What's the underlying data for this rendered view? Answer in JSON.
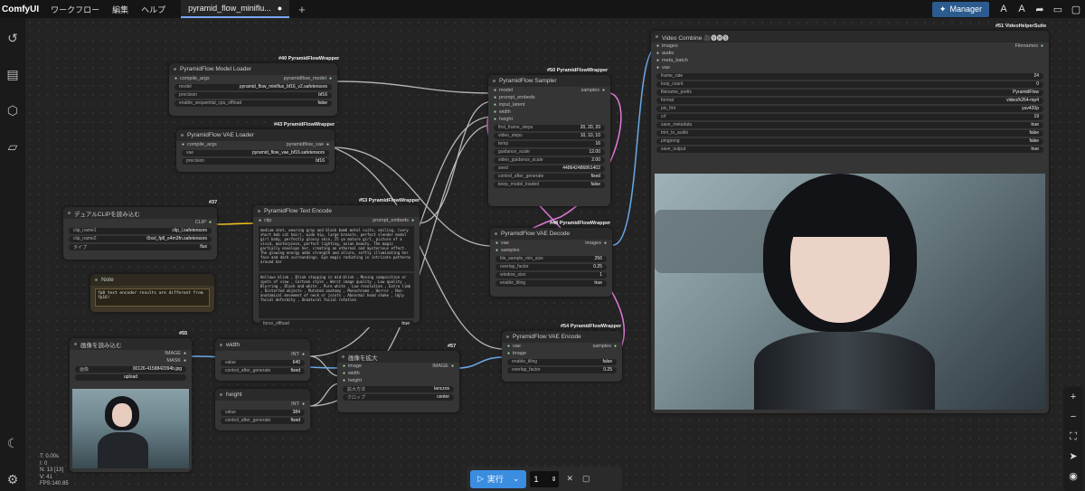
{
  "topbar": {
    "logo": "ComfyUI",
    "menu": [
      "ワークフロー",
      "編集",
      "ヘルプ"
    ],
    "tab": "pyramid_flow_miniflu...",
    "tab_dot": "●",
    "plus": "+",
    "manager": "Manager"
  },
  "nodes": {
    "model_loader": {
      "tag": "#40 PyramidFlowWrapper",
      "title": "PyramidFlow Model Loader",
      "in": "compile_args",
      "out": "pyramidflow_model",
      "w": [
        [
          "model",
          "pyramid_flow_miniflux_bf16_v2.safetensors"
        ],
        [
          "precision",
          "bf16"
        ]
      ],
      "toggle": [
        "enable_sequential_cpu_offload",
        "false"
      ]
    },
    "vae_loader": {
      "tag": "#43 PyramidFlowWrapper",
      "title": "PyramidFlow VAE Loader",
      "in": "compile_args",
      "out": "pyramidflow_vae",
      "w": [
        [
          "vae",
          "pyramid_flow_vae_bf16.safetensors"
        ],
        [
          "precision",
          "bf16"
        ]
      ]
    },
    "clip": {
      "tag": "#37",
      "title": "デュアルCLIPを読み込む",
      "out": "CLIP",
      "w": [
        [
          "clip_name1",
          "clip_l.safetensors"
        ],
        [
          "clip_name2",
          "t5xxl_fp8_e4m3fn.safetensors"
        ],
        [
          "タイプ",
          "flux"
        ]
      ]
    },
    "note": {
      "title": "Note",
      "text": "fp8 text encoder results are different from fp16!"
    },
    "text_encode": {
      "tag": "#53 PyramidFlowWrapper",
      "title": "PyramidFlow Text Encode",
      "in": "clip",
      "out": "prompt_embeds",
      "pos": "medium shot, wearing gray and black bomb metal suits, smiling, (very short bob cut hair), wide hip, large breasts, perfect slender model girl body, perfectly glossy skin, 25 yo mature girl, picture of a vivid, masterpiece, perfect lighting, asian beauty. The magic partially envelops her, creating an ethereal and mysterious effect. The glowing energy adds strength and allure, softly illuminating her face and dark surroundings. Eye magic radiating in intricate patterns around her",
      "neg": "Hollows blink , Blink stopping in mid-blink , Moving composition or spots of view , Cartoon style , Worst image quality , Low quality , Blurring , Black and white , Pure white , Low resolution , Extra limb , Distorted objects , Mutated anatomy , Monochrome , Horror , Non-anatomical movement of neck or joints , Abnormal head shake , Ugly facial deformity , Unnatural facial rotation",
      "toggle": [
        "force_offload",
        "true"
      ]
    },
    "sampler": {
      "tag": "#50 PyramidFlowWrapper",
      "title": "PyramidFlow Sampler",
      "ins": [
        "model",
        "prompt_embeds",
        "input_latent",
        "width",
        "height"
      ],
      "out": "samples",
      "w": [
        [
          "first_frame_steps",
          "20, 20, 20"
        ],
        [
          "video_steps",
          "10, 10, 10"
        ],
        [
          "temp",
          "16"
        ],
        [
          "guidance_scale",
          "12.00"
        ],
        [
          "video_guidance_scale",
          "2.00"
        ],
        [
          "seed",
          "448642486861402"
        ],
        [
          "control_after_generate",
          "fixed"
        ]
      ],
      "toggle": [
        "keep_model_loaded",
        "false"
      ]
    },
    "vae_decode": {
      "tag": "#48 PyramidFlowWrapper",
      "title": "PyramidFlow VAE Decode",
      "ins": [
        "vae",
        "samples"
      ],
      "out": "images",
      "w": [
        [
          "tile_sample_min_size",
          "256"
        ],
        [
          "overlap_factor",
          "0.25"
        ],
        [
          "window_size",
          "1"
        ]
      ],
      "toggle": [
        "enable_tiling",
        "true"
      ]
    },
    "vae_encode": {
      "tag": "#54 PyramidFlowWrapper",
      "title": "PyramidFlow VAE Encode",
      "ins": [
        "vae",
        "image"
      ],
      "out": "samples",
      "toggle": [
        "enable_tiling",
        "false"
      ],
      "w": [
        [
          "overlap_factor",
          "0.25"
        ]
      ]
    },
    "load_image": {
      "tag": "#55",
      "title": "画像を読み込む",
      "outs": [
        "IMAGE",
        "MASK"
      ],
      "w": [
        [
          "画像",
          "00126-4158842094b.jpg"
        ]
      ],
      "upload": "upload"
    },
    "width": {
      "title": "width",
      "out": "INT",
      "w": [
        [
          "value",
          "640"
        ],
        [
          "control_after_generate",
          "fixed"
        ]
      ]
    },
    "height": {
      "title": "height",
      "out": "INT",
      "w": [
        [
          "value",
          "384"
        ],
        [
          "control_after_generate",
          "fixed"
        ]
      ]
    },
    "upscale": {
      "tag": "#57",
      "title": "画像を拡大",
      "ins": [
        "image",
        "width",
        "height"
      ],
      "out": "IMAGE",
      "w": [
        [
          "拡大方法",
          "lanczos"
        ],
        [
          "クロップ",
          "center"
        ]
      ]
    },
    "video_combine": {
      "tag": "#51 VideoHelperSuite",
      "title": "Video Combine 🎥🅥🅗🅢",
      "ins": [
        "images",
        "audio",
        "meta_batch",
        "vae"
      ],
      "out": "Filenames",
      "w": [
        [
          "frame_rate",
          "24"
        ],
        [
          "loop_count",
          "0"
        ],
        [
          "filename_prefix",
          "PyramidFlow"
        ],
        [
          "format",
          "video/h264-mp4"
        ],
        [
          "pix_fmt",
          "yuv420p"
        ],
        [
          "crf",
          "19"
        ]
      ],
      "toggles": [
        [
          "save_metadata",
          "true"
        ],
        [
          "trim_to_audio",
          "false"
        ],
        [
          "pingpong",
          "false"
        ],
        [
          "save_output",
          "true"
        ]
      ]
    }
  },
  "hud": [
    "T: 0.00s",
    "I: 0",
    "N: 13 [13]",
    "V: 41",
    "FPS:140.85"
  ],
  "runbar": {
    "run": "実行",
    "count": "1"
  },
  "colors": {
    "accent": "#3b8de0",
    "link_blue": "#6aa8e8",
    "link_pink": "#e07ad8",
    "link_yellow": "#f0c020",
    "link_grey": "#b8b8b8"
  }
}
